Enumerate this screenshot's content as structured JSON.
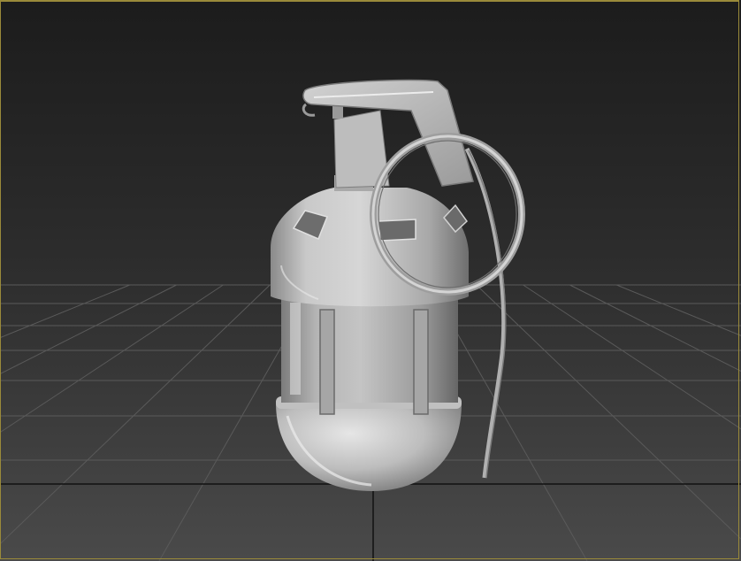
{
  "viewport": {
    "mode": "perspective",
    "shading": "default-shading",
    "active": true,
    "grid_visible": true,
    "active_border_color": "#9a8a3a",
    "background_top_color": "#1d1d1d",
    "background_bottom_color": "#474747",
    "grid_color": "#5c5c5c",
    "grid_axis_color": "#111111"
  },
  "scene": {
    "object": "hand-grenade-model",
    "parts": [
      "fuse-lever",
      "fuse-head",
      "body-upper-dome",
      "body-band",
      "body-lower-dome",
      "pull-ring",
      "safety-pin"
    ],
    "material_color": "#c8c8c8"
  }
}
